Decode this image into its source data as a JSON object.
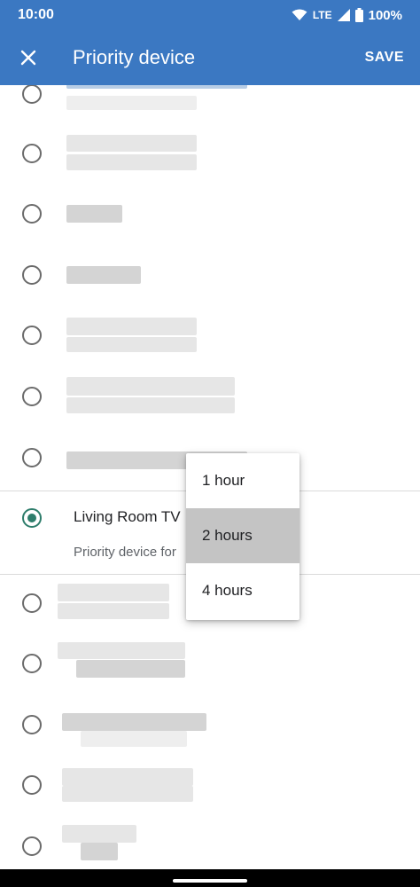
{
  "status_bar": {
    "time": "10:00",
    "network": "LTE",
    "battery": "100%"
  },
  "app_bar": {
    "title": "Priority device",
    "save_label": "SAVE",
    "close_icon": "close-icon"
  },
  "selected_device": {
    "name": "Living Room TV",
    "subtitle": "Priority device for"
  },
  "duration_menu": {
    "items": [
      {
        "label": "1 hour"
      },
      {
        "label": "2 hours"
      },
      {
        "label": "4 hours"
      }
    ],
    "highlighted": "2 hours"
  },
  "colors": {
    "app_bar": "#3b78c2",
    "radio_checked": "#2e7d6b",
    "menu_highlight": "#c4c4c4"
  }
}
